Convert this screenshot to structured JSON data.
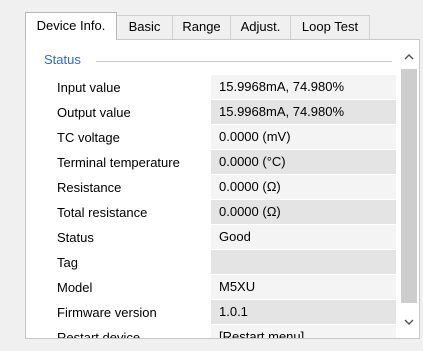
{
  "tabs": [
    {
      "label": "Device Info.",
      "active": true
    },
    {
      "label": "Basic",
      "active": false
    },
    {
      "label": "Range",
      "active": false
    },
    {
      "label": "Adjust.",
      "active": false
    },
    {
      "label": "Loop Test",
      "active": false
    }
  ],
  "status_group": {
    "title": "Status",
    "rows": [
      {
        "label": "Input value",
        "value": "15.9968mA, 74.980%"
      },
      {
        "label": "Output value",
        "value": "15.9968mA, 74.980%"
      },
      {
        "label": "TC voltage",
        "value": "0.0000 (mV)"
      },
      {
        "label": "Terminal temperature",
        "value": "0.0000 (°C)"
      },
      {
        "label": "Resistance",
        "value": "0.0000 (Ω)"
      },
      {
        "label": "Total resistance",
        "value": "0.0000 (Ω)"
      },
      {
        "label": "Status",
        "value": "Good"
      },
      {
        "label": "Tag",
        "value": ""
      },
      {
        "label": "Model",
        "value": "M5XU"
      },
      {
        "label": "Firmware version",
        "value": "1.0.1"
      },
      {
        "label": "Restart device",
        "value": "[Restart menu]"
      }
    ]
  },
  "scrollbar": {
    "up_icon": "chevron-up-icon",
    "down_icon": "chevron-down-icon"
  },
  "colors": {
    "group_title": "#2b6cc4",
    "value_bg": "#e4e4e4",
    "thumb": "#cdcdcd"
  }
}
